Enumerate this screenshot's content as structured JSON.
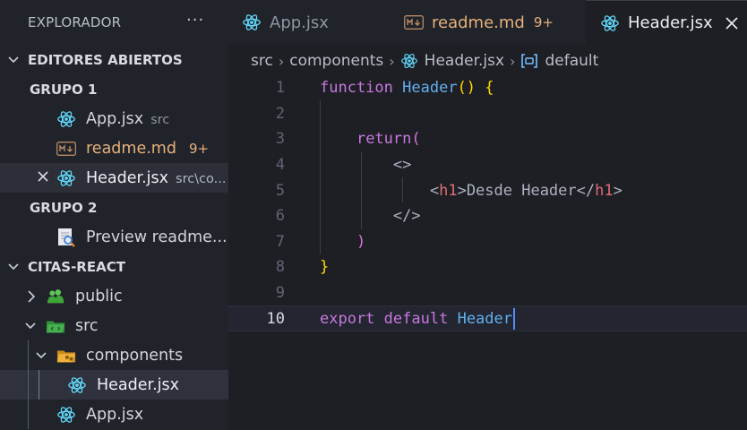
{
  "explorer": {
    "title": "EXPLORADOR",
    "more_label": "···",
    "open_editors_label": "EDITORES ABIERTOS",
    "groups": [
      {
        "label": "GRUPO 1",
        "items": [
          {
            "name": "App.jsx",
            "desc": "src",
            "icon": "react-icon"
          },
          {
            "name": "readme.md",
            "badge": "9+",
            "icon": "markdown-icon"
          },
          {
            "name": "Header.jsx",
            "desc": "src\\co...",
            "icon": "react-icon"
          }
        ]
      },
      {
        "label": "GRUPO 2",
        "items": [
          {
            "name": "Preview readme....",
            "icon": "preview-icon"
          }
        ]
      }
    ],
    "project_label": "CITAS-REACT",
    "tree": [
      {
        "name": "public",
        "icon": "folder-public-icon"
      },
      {
        "name": "src",
        "icon": "folder-src-icon"
      },
      {
        "name": "components",
        "icon": "folder-components-icon"
      },
      {
        "name": "Header.jsx",
        "icon": "react-icon"
      },
      {
        "name": "App.jsx",
        "icon": "react-icon"
      }
    ]
  },
  "tabs": [
    {
      "label": "App.jsx",
      "icon": "react-icon"
    },
    {
      "label": "readme.md",
      "badge": "9+",
      "icon": "markdown-icon"
    },
    {
      "label": "Header.jsx",
      "icon": "react-icon",
      "active": true
    }
  ],
  "breadcrumb": {
    "parts": [
      "src",
      "components",
      "Header.jsx",
      "default"
    ]
  },
  "editor": {
    "line_numbers": [
      "1",
      "2",
      "3",
      "4",
      "5",
      "6",
      "7",
      "8",
      "9",
      "10"
    ],
    "current_line": 10,
    "tokens": {
      "l1_kw": "function",
      "l1_fn": "Header",
      "l1_paren": "()",
      "l1_brace": "{",
      "l3_kw": "return",
      "l3_paren": "(",
      "l4_frag": "<>",
      "l5_open_lt": "<",
      "l5_open_tag": "h1",
      "l5_open_gt": ">",
      "l5_text": "Desde Header",
      "l5_close_lt": "</",
      "l5_close_tag": "h1",
      "l5_close_gt": ">",
      "l6_frag": "</>",
      "l7_paren": ")",
      "l8_brace": "}",
      "l10_kw1": "export",
      "l10_kw2": "default",
      "l10_fn": "Header"
    }
  },
  "colors": {
    "keyword": "#c678dd",
    "function": "#61afef",
    "tag": "#e06c75",
    "bracket_gold": "#ffd700",
    "bracket_orchid": "#da70d6",
    "modified": "#e5b07a",
    "react": "#61dafb"
  }
}
